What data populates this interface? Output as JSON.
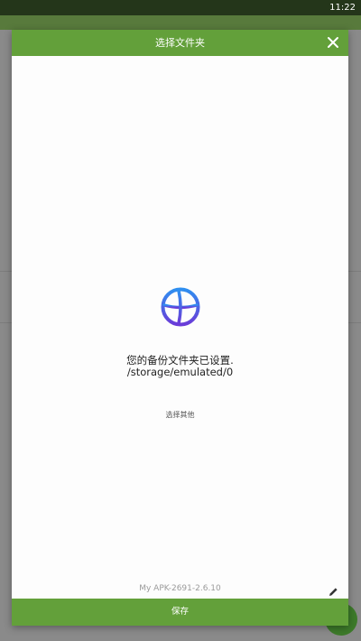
{
  "status_bar": {
    "time": "11:22"
  },
  "dialog": {
    "title": "选择文件夹",
    "close_icon": "close-icon",
    "folder_icon": "globe-logo-icon",
    "status_message": "您的备份文件夹已设置.",
    "path": "/storage/emulated/0",
    "choose_other_label": "选择其他",
    "version": "My APK-2691-2.6.10",
    "edit_icon": "pencil-icon",
    "save_label": "保存"
  },
  "colors": {
    "header": "#63a03a",
    "status_bar": "#24361a",
    "logo_top": "#2f8ff0",
    "logo_bottom": "#6a3bd8"
  }
}
